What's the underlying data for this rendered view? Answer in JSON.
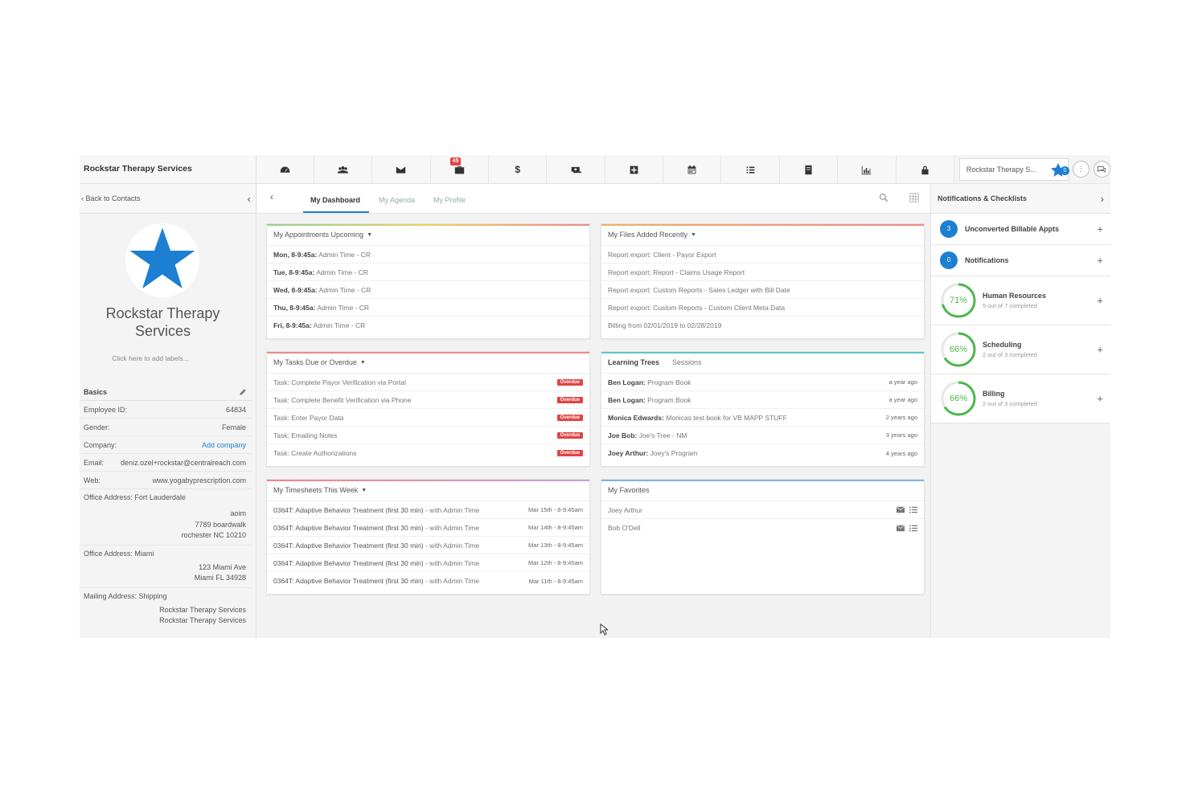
{
  "app_title": "Rockstar Therapy Services",
  "nav": {
    "badge": "45",
    "account_name": "Rockstar Therapy S...",
    "star_count": "0",
    "icons": [
      "dashboard-icon",
      "contacts-icon",
      "messages-icon",
      "briefcase-icon",
      "billing-icon",
      "payments-icon",
      "medical-icon",
      "calendar-icon",
      "tasks-icon",
      "files-icon",
      "reports-icon",
      "lock-icon"
    ]
  },
  "left_head": {
    "back_label": "Back to Contacts"
  },
  "tabs": {
    "dashboard": "My Dashboard",
    "agenda": "My Agenda",
    "profile": "My Profile"
  },
  "right_head": {
    "title": "Notifications & Checklists"
  },
  "profile": {
    "name_line1": "Rockstar Therapy",
    "name_line2": "Services",
    "labels_hint": "Click here to add labels...",
    "basics_title": "Basics",
    "employee_label": "Employee ID:",
    "employee_value": "64834",
    "gender_label": "Gender:",
    "gender_value": "Female",
    "company_label": "Company:",
    "company_value": "Add company",
    "email_label": "Email:",
    "email_value": "deniz.ozel+rockstar@centralreach.com",
    "web_label": "Web:",
    "web_value": "www.yogabyprescription.com",
    "addr1_title": "Office Address: Fort Lauderdale",
    "addr1_l1": "aoim",
    "addr1_l2": "7789 boardwalk",
    "addr1_l3": "rochester NC 10210",
    "addr2_title": "Office Address: Miami",
    "addr2_l1": "123 Miami Ave",
    "addr2_l2": "Miami FL 34928",
    "addr3_title": "Mailing Address: Shipping",
    "addr3_l1": "Rockstar Therapy Services",
    "addr3_l2": "Rockstar Therapy Services"
  },
  "appointments": {
    "title": "My Appointments Upcoming",
    "rows": [
      {
        "day": "Mon, 8-9:45a:",
        "desc": " Admin Time - CR"
      },
      {
        "day": "Tue, 8-9:45a:",
        "desc": " Admin Time - CR"
      },
      {
        "day": "Wed, 8-9:45a:",
        "desc": " Admin Time - CR"
      },
      {
        "day": "Thu, 8-9:45a:",
        "desc": " Admin Time - CR"
      },
      {
        "day": "Fri, 8-9:45a:",
        "desc": " Admin Time - CR"
      }
    ]
  },
  "files": {
    "title": "My Files Added Recently",
    "rows": [
      "Report export: Client - Payor Export",
      "Report export: Report - Claims Usage Report",
      "Report export: Custom Reports - Sales Ledger with Bill Date",
      "Report export: Custom Reports - Custom Client Meta Data",
      "Billing from 02/01/2019 to 02/28/2019"
    ]
  },
  "tasks": {
    "title": "My Tasks Due or Overdue",
    "badge": "Overdue",
    "rows": [
      "Task: Complete Payor Verification via Portal",
      "Task: Complete Benefit Verification via Phone",
      "Task: Enter Payor Data",
      "Task: Emailing Notes",
      "Task: Create Authorizations"
    ]
  },
  "learning": {
    "title": "Learning Trees",
    "sessions": "Sessions",
    "rows": [
      {
        "who": "Ben Logan:",
        "what": " Program Book",
        "when": "a year ago"
      },
      {
        "who": "Ben Logan:",
        "what": " Program Book",
        "when": "a year ago"
      },
      {
        "who": "Monica Edwards:",
        "what": " Monicas test book for VB MAPP STUFF",
        "when": "2 years ago"
      },
      {
        "who": "Joe Bob:",
        "what": " Joe's Tree - NM",
        "when": "3 years ago"
      },
      {
        "who": "Joey Arthur:",
        "what": " Joey's Program",
        "when": "4 years ago"
      }
    ]
  },
  "timesheets": {
    "title": "My Timesheets This Week",
    "rows": [
      {
        "code": "0364T: Adaptive Behavior Treatment (first 30 min)",
        "with": " - with Admin Time",
        "date": "Mar 15th - 8-9:45am"
      },
      {
        "code": "0364T: Adaptive Behavior Treatment (first 30 min)",
        "with": " - with Admin Time",
        "date": "Mar 14th - 8-9:45am"
      },
      {
        "code": "0364T: Adaptive Behavior Treatment (first 30 min)",
        "with": " - with Admin Time",
        "date": "Mar 13th - 8-9:45am"
      },
      {
        "code": "0364T: Adaptive Behavior Treatment (first 30 min)",
        "with": " - with Admin Time",
        "date": "Mar 12th - 8-9:45am"
      },
      {
        "code": "0364T: Adaptive Behavior Treatment (first 30 min)",
        "with": " - with Admin Time",
        "date": "Mar 11th - 8-9:45am"
      }
    ]
  },
  "favorites": {
    "title": "My Favorites",
    "rows": [
      "Joey Arthur",
      "Bob O'Dell"
    ]
  },
  "checklists": {
    "unconverted_count": "3",
    "unconverted_label": "Unconverted Billable Appts",
    "notifications_count": "0",
    "notifications_label": "Notifications",
    "items": [
      {
        "pct": "71%",
        "frac": 0.71,
        "title": "Human Resources",
        "sub": "5 out of 7 completed"
      },
      {
        "pct": "66%",
        "frac": 0.66,
        "title": "Scheduling",
        "sub": "2 out of 3 completed"
      },
      {
        "pct": "66%",
        "frac": 0.66,
        "title": "Billing",
        "sub": "2 out of 3 completed"
      }
    ]
  },
  "colors": {
    "accent": "#1d7fd1",
    "overdue": "#e04545",
    "progress": "#4cb84c"
  }
}
